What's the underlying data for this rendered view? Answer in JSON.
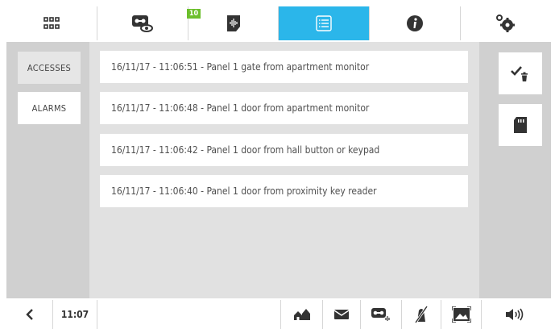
{
  "top_tabs": [
    {
      "icon": "grid-icon"
    },
    {
      "icon": "voicemail-view-icon",
      "badge": "10"
    },
    {
      "icon": "audio-note-icon"
    },
    {
      "icon": "list-icon"
    },
    {
      "icon": "info-icon"
    },
    {
      "icon": "settings-gear-icon"
    }
  ],
  "sidebar": {
    "items": [
      {
        "label": "ACCESSES"
      },
      {
        "label": "ALARMS"
      }
    ]
  },
  "log": {
    "entries": [
      {
        "text": "16/11/17 - 11:06:51 - Panel 1 gate from apartment monitor"
      },
      {
        "text": "16/11/17 - 11:06:48 - Panel 1 door from apartment monitor"
      },
      {
        "text": "16/11/17 - 11:06:42 - Panel 1 door from hall button or keypad"
      },
      {
        "text": "16/11/17 - 11:06:40 - Panel 1 door from proximity key reader"
      }
    ]
  },
  "actions": [
    {
      "icon": "check-delete-icon"
    },
    {
      "icon": "sd-card-icon"
    }
  ],
  "bottom": {
    "time": "11:07"
  },
  "colors": {
    "accent": "#2bb6ea",
    "badge": "#6cbf2c"
  }
}
